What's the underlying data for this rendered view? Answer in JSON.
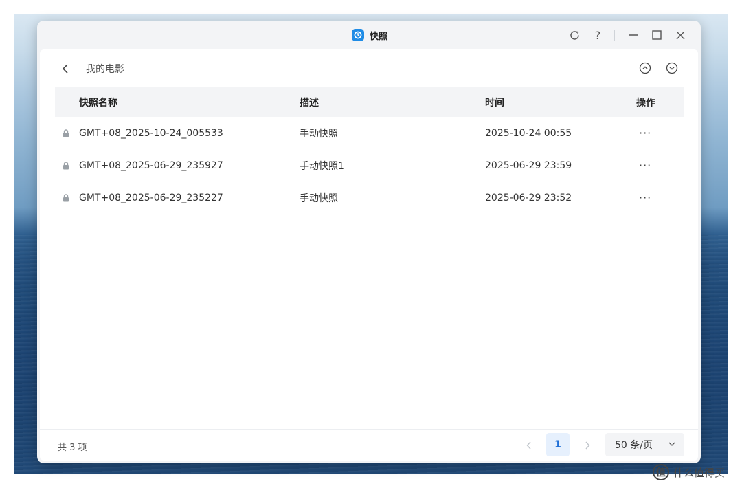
{
  "window": {
    "title": "快照",
    "controls": [
      "refresh-icon",
      "help-icon",
      "minimize-icon",
      "maximize-icon",
      "close-icon"
    ]
  },
  "breadcrumb": {
    "label": "我的电影"
  },
  "table": {
    "headers": [
      "快照名称",
      "描述",
      "时间",
      "操作"
    ],
    "rows": [
      {
        "name": "GMT+08_2025-10-24_005533",
        "desc": "手动快照",
        "time": "2025-10-24 00:55",
        "action": "···"
      },
      {
        "name": "GMT+08_2025-06-29_235927",
        "desc": "手动快照1",
        "time": "2025-06-29 23:59",
        "action": "···"
      },
      {
        "name": "GMT+08_2025-06-29_235227",
        "desc": "手动快照",
        "time": "2025-06-29 23:52",
        "action": "···"
      }
    ]
  },
  "footer": {
    "count": "共 3 项",
    "current_page": "1",
    "page_size": "50 条/页"
  },
  "watermark": {
    "logo": "值",
    "text": "什么值得买"
  },
  "colors": {
    "accent": "#1f6fd6",
    "app_icon": "#1f8ce6"
  }
}
